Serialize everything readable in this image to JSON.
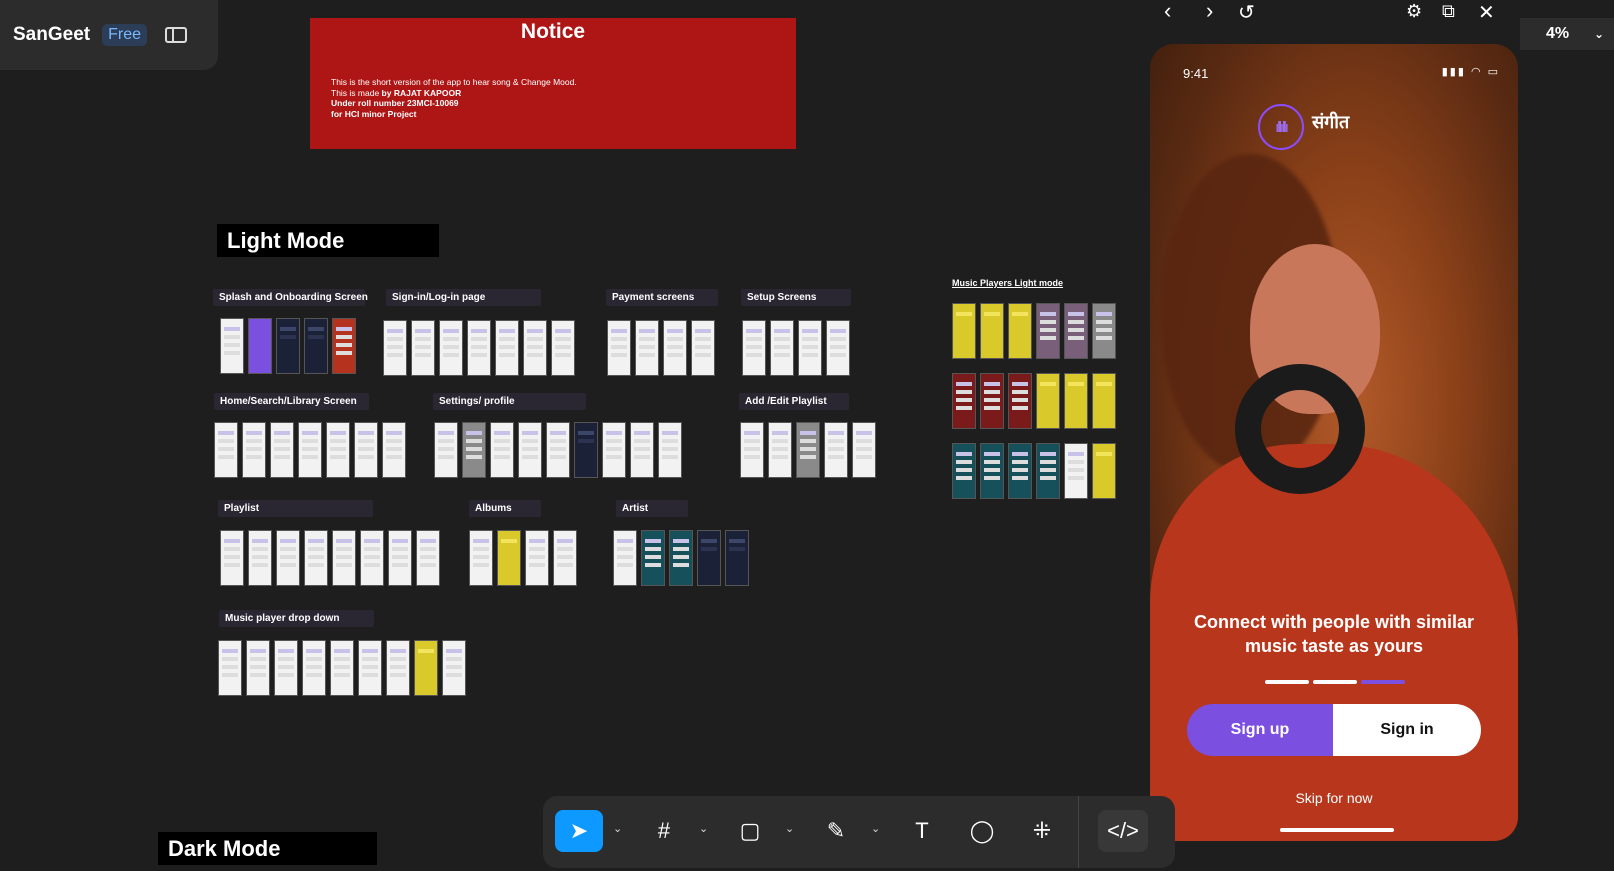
{
  "file": {
    "name": "SanGeet",
    "plan": "Free"
  },
  "notice": {
    "title": "Notice",
    "line1": "This is the short version of the app to hear song & Change Mood.",
    "line2_prefix": "This is made ",
    "line2_bold": "by RAJAT KAPOOR",
    "line3": "Under roll number 23MCI-10069",
    "line4": "for HCI minor Project"
  },
  "canvas": {
    "light_mode": "Light Mode",
    "dark_mode": "Dark Mode",
    "sections": {
      "splash": "Splash and  Onboarding Screen",
      "signin": "Sign-in/Log-in page",
      "payment": "Payment screens",
      "setup": "Setup Screens",
      "home": "Home/Search/Library Screen",
      "settings": "Settings/ profile",
      "playlist_edit": "Add /Edit Playlist",
      "playlist": "Playlist",
      "albums": "Albums",
      "artist": "Artist",
      "player_drop": "Music player drop down",
      "players_light": "Music Players Light mode"
    }
  },
  "preview": {
    "zoom": "4%",
    "status_time": "9:41",
    "app_name": "संगीत",
    "tagline_line1": "Connect with people with similar",
    "tagline_line2": "music taste as yours",
    "signup_label": "Sign up",
    "signin_label": "Sign in",
    "skip_label": "Skip for now",
    "pager": {
      "pages": 3,
      "active_page": 3
    }
  },
  "colors": {
    "accent": "#7b4fe0",
    "notice_bg": "#ae1515",
    "tool_active": "#0d99ff"
  }
}
